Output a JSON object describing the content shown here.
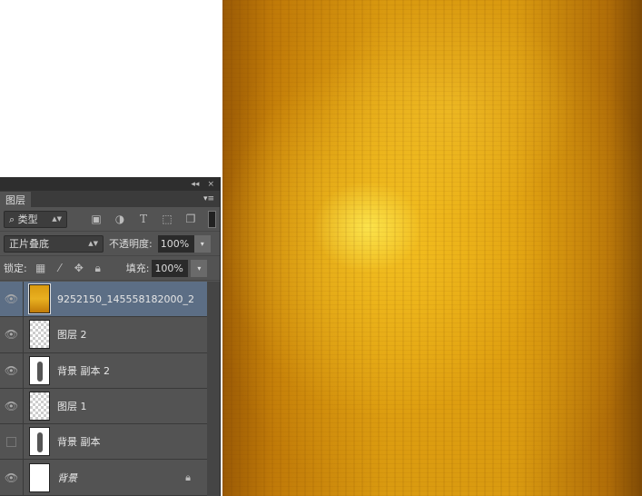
{
  "panel": {
    "collapse": "◂◂",
    "close": "×",
    "tab": "图层",
    "menu": "▾≡",
    "filter": {
      "label": "类型",
      "search_icon": "⌕"
    },
    "blend_mode": "正片叠底",
    "opacity_label": "不透明度:",
    "opacity": "100%",
    "lock_label": "锁定:",
    "fill_label": "填充:",
    "fill": "100%"
  },
  "layers": [
    {
      "name": "9252150_145558182000_2",
      "visible": true,
      "active": true
    },
    {
      "name": "图层 2",
      "visible": true
    },
    {
      "name": "背景 副本 2",
      "visible": true
    },
    {
      "name": "图层 1",
      "visible": true
    },
    {
      "name": "背景 副本",
      "visible": false
    },
    {
      "name": "背景",
      "visible": true,
      "locked": true
    }
  ]
}
